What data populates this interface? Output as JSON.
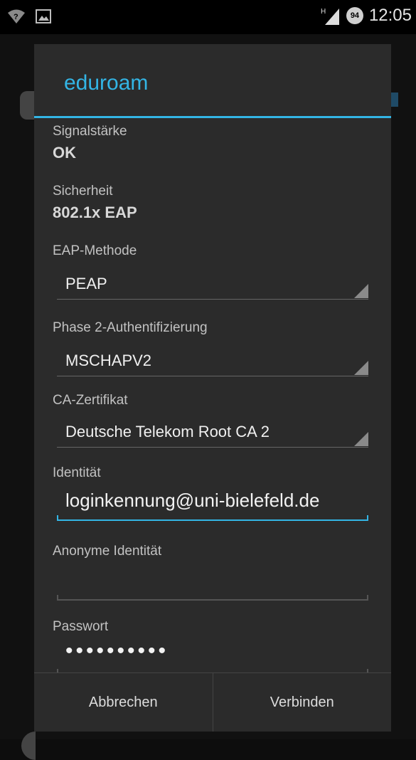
{
  "status_bar": {
    "clock": "12:05",
    "network_type": "H",
    "battery_level": "94",
    "icons": [
      "wifi-question-icon",
      "image-notification-icon",
      "signal-icon",
      "battery-icon"
    ]
  },
  "dialog": {
    "title": "eduroam",
    "fields": {
      "signal_label": "Signalstärke",
      "signal_value": "OK",
      "security_label": "Sicherheit",
      "security_value": "802.1x EAP",
      "eap_label": "EAP-Methode",
      "eap_value": "PEAP",
      "phase2_label": "Phase 2-Authentifizierung",
      "phase2_value": "MSCHAPV2",
      "ca_label": "CA-Zertifikat",
      "ca_value": "Deutsche Telekom Root CA 2",
      "identity_label": "Identität",
      "identity_value": "loginkennung@uni-bielefeld.de",
      "anon_label": "Anonyme Identität",
      "anon_value": "",
      "password_label": "Passwort",
      "password_value": "••••••••••"
    },
    "buttons": {
      "cancel": "Abbrechen",
      "connect": "Verbinden"
    }
  },
  "colors": {
    "accent": "#33b5e5",
    "dialog_bg": "#2b2b2b"
  }
}
